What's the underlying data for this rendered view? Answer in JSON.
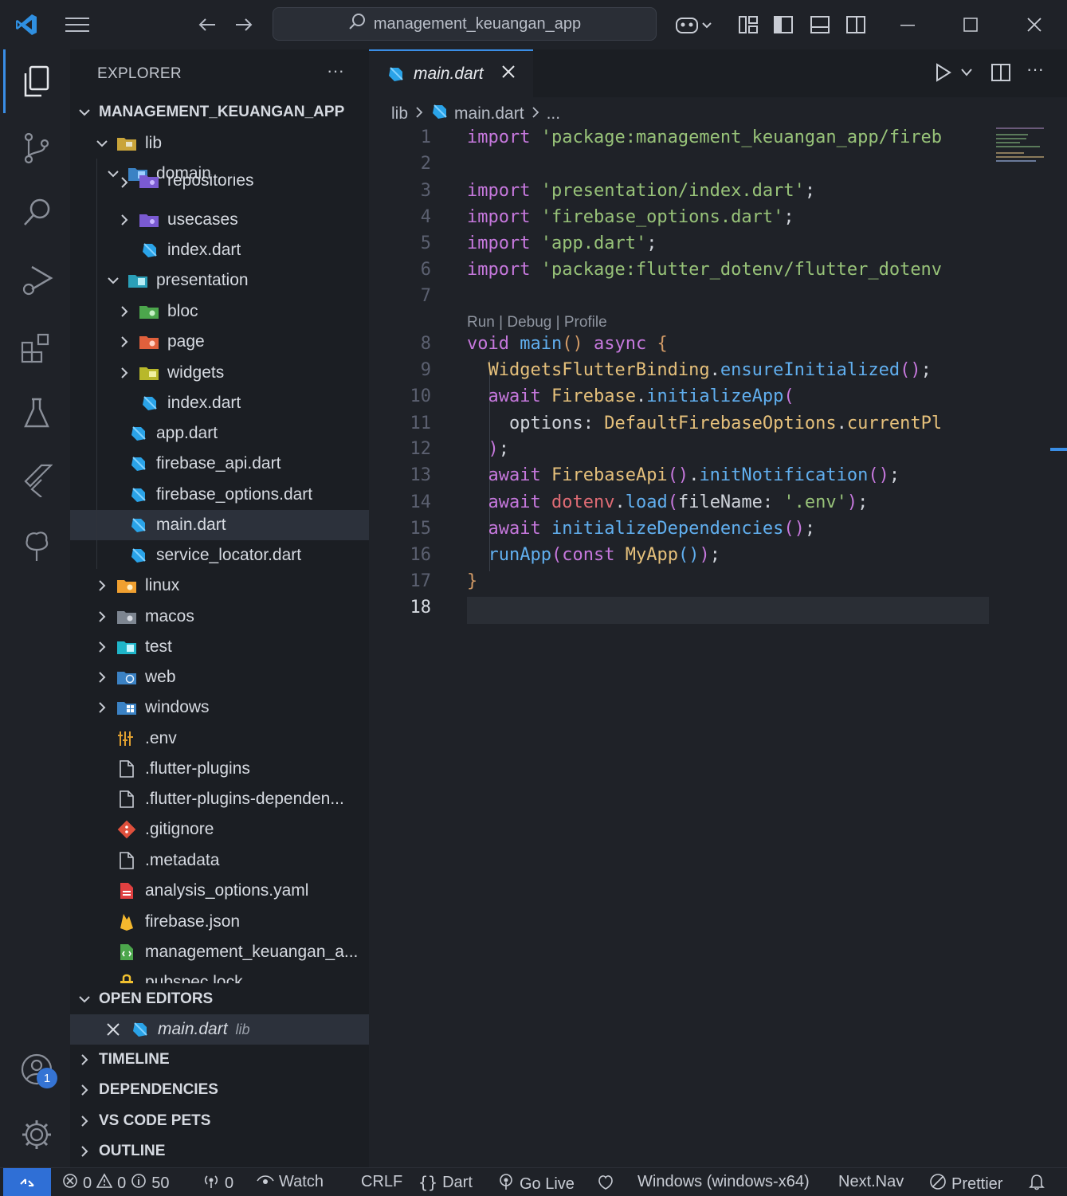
{
  "titlebar": {
    "search_text": "management_keuangan_app"
  },
  "sidebar": {
    "title": "EXPLORER",
    "more": "···",
    "root": "MANAGEMENT_KEUANGAN_APP",
    "tree": [
      {
        "label": "lib"
      },
      {
        "label": "domain"
      },
      {
        "label": "repositories"
      },
      {
        "label": "usecases"
      },
      {
        "label": "index.dart"
      },
      {
        "label": "presentation"
      },
      {
        "label": "bloc"
      },
      {
        "label": "page"
      },
      {
        "label": "widgets"
      },
      {
        "label": "index.dart"
      },
      {
        "label": "app.dart"
      },
      {
        "label": "firebase_api.dart"
      },
      {
        "label": "firebase_options.dart"
      },
      {
        "label": "main.dart"
      },
      {
        "label": "service_locator.dart"
      },
      {
        "label": "linux"
      },
      {
        "label": "macos"
      },
      {
        "label": "test"
      },
      {
        "label": "web"
      },
      {
        "label": "windows"
      },
      {
        "label": ".env"
      },
      {
        "label": ".flutter-plugins"
      },
      {
        "label": ".flutter-plugins-dependen..."
      },
      {
        "label": ".gitignore"
      },
      {
        "label": ".metadata"
      },
      {
        "label": "analysis_options.yaml"
      },
      {
        "label": "firebase.json"
      },
      {
        "label": "management_keuangan_a..."
      },
      {
        "label": "pubspec.lock"
      }
    ],
    "open_editors": {
      "title": "OPEN EDITORS",
      "file": "main.dart",
      "dir": "lib"
    },
    "sections": [
      "TIMELINE",
      "DEPENDENCIES",
      "VS CODE PETS",
      "OUTLINE"
    ]
  },
  "activity": {
    "badge": "1"
  },
  "editor": {
    "tab": "main.dart",
    "breadcrumb": {
      "folder": "lib",
      "file": "main.dart",
      "more": "..."
    },
    "codelens": "Run | Debug | Profile",
    "line_numbers": [
      "1",
      "2",
      "3",
      "4",
      "5",
      "6",
      "7",
      "8",
      "9",
      "10",
      "11",
      "12",
      "13",
      "14",
      "15",
      "16",
      "17",
      "18"
    ],
    "lines": {
      "l1_kw": "import",
      "l1_str": "'package:management_keuangan_app/fireb",
      "l3_kw": "import",
      "l3_str": "'presentation/index.dart'",
      "semi": ";",
      "l4_kw": "import",
      "l4_str": "'firebase_options.dart'",
      "l5_kw": "import",
      "l5_str": "'app.dart'",
      "l6_kw": "import",
      "l6_str": "'package:flutter_dotenv/flutter_dotenv",
      "l8_void": "void",
      "l8_main": "main",
      "l8_paren": "()",
      "l8_async": "async",
      "l8_brace": "{",
      "l9_cls": "WidgetsFlutterBinding",
      "l9_fn": "ensureInitialized",
      "l9_p": "()",
      "l10_await": "await",
      "l10_cls": "Firebase",
      "l10_fn": "initializeApp",
      "l10_open": "(",
      "l11_prop": "options:",
      "l11_cls": "DefaultFirebaseOptions",
      "l11_field": "currentPl",
      "l12_close": ")",
      "l13_await": "await",
      "l13_cls": "FirebaseApi",
      "l13_p": "()",
      "l13_fn": "initNotification",
      "l14_await": "await",
      "l14_obj": "dotenv",
      "l14_fn": "load",
      "l14_arg": "fileName:",
      "l14_str": "'.env'",
      "l15_await": "await",
      "l15_fn": "initializeDependencies",
      "l16_fn": "runApp",
      "l16_const": "const",
      "l16_cls": "MyApp",
      "l17_brace": "}"
    }
  },
  "statusbar": {
    "errors": "0",
    "warnings": "0",
    "infos": "50",
    "ports": "0",
    "watch": "Watch",
    "eol": "CRLF",
    "lang": "Dart",
    "golive": "Go Live",
    "device": "Windows (windows-x64)",
    "nav": "Next.Nav",
    "prettier": "Prettier"
  },
  "colors": {
    "accent": "#3a8ee6",
    "badge": "#3574d4",
    "remote": "#2f6fd6"
  }
}
